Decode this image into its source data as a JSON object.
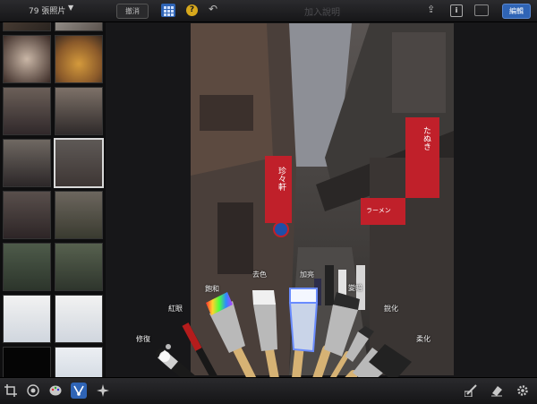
{
  "header": {
    "photo_count": "79 張照片",
    "undo_label": "撤消",
    "help_label": "?",
    "title": "加入說明",
    "info_label": "i",
    "edit_label": "編輯"
  },
  "brushes": [
    {
      "label": "修復"
    },
    {
      "label": "紅眼"
    },
    {
      "label": "飽和"
    },
    {
      "label": "去色"
    },
    {
      "label": "加亮"
    },
    {
      "label": "變暗"
    },
    {
      "label": "銳化"
    },
    {
      "label": "柔化"
    }
  ],
  "photo_signs": {
    "vertical_sign": "珍々軒",
    "right_sign": "たぬき",
    "small_sign": "ラーメン"
  },
  "colors": {
    "accent": "#2f64b5",
    "help": "#d7a81c",
    "sign_red": "#c0202a"
  }
}
